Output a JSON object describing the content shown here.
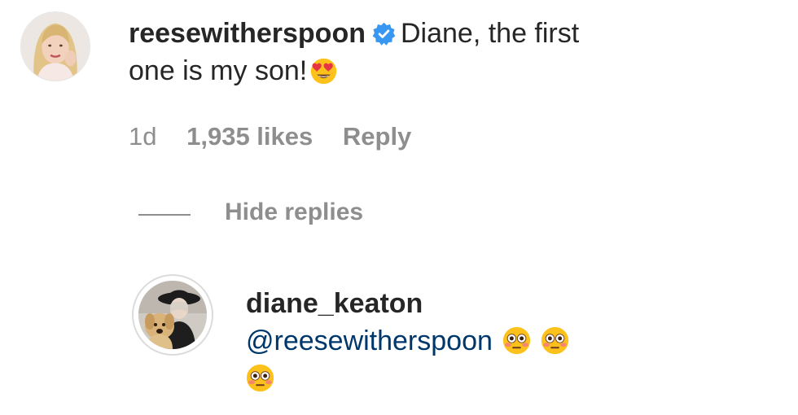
{
  "comment": {
    "username": "reesewitherspoon",
    "verified": true,
    "text": "Diane, the first one is my son!",
    "emoji": "heart-eyes-emoji",
    "time": "1d",
    "likes": "1,935 likes",
    "reply_label": "Reply"
  },
  "hide_replies_label": "Hide replies",
  "reply": {
    "username": "diane_keaton",
    "mention": "@reesewitherspoon",
    "emojis": [
      "flushed-face-emoji",
      "flushed-face-emoji",
      "flushed-face-emoji"
    ]
  },
  "colors": {
    "text": "#262626",
    "secondary": "#8e8e8e",
    "mention": "#00376b",
    "verified": "#3897f0"
  }
}
